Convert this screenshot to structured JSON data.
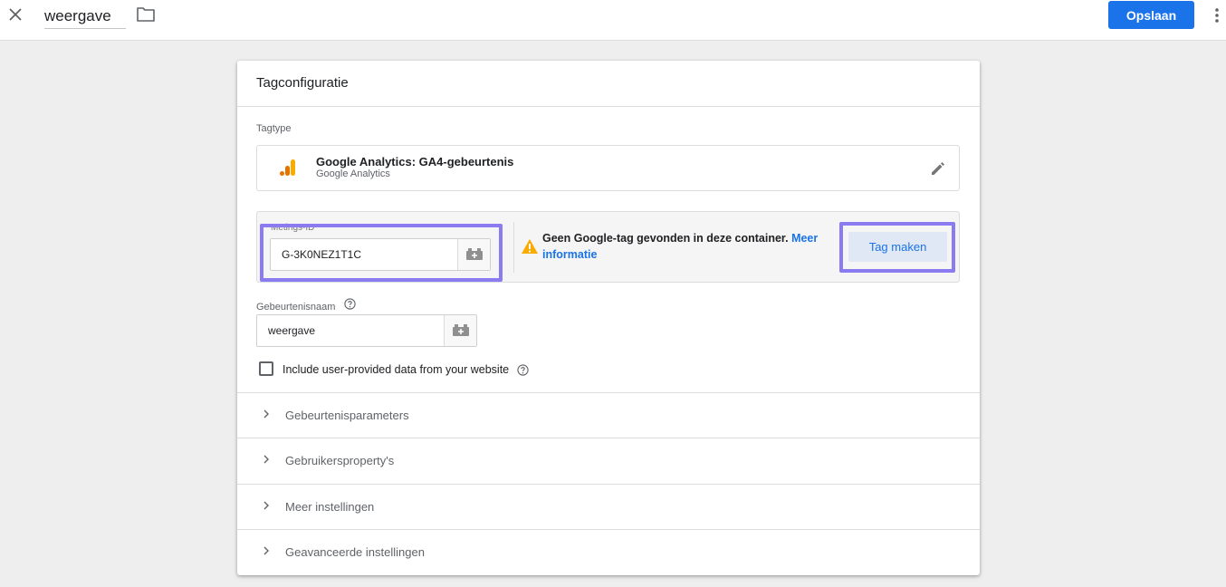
{
  "topbar": {
    "tag_name_value": "weergave",
    "save_label": "Opslaan"
  },
  "card": {
    "title": "Tagconfiguratie",
    "tagtype_label": "Tagtype",
    "tagtype_name": "Google Analytics: GA4-gebeurtenis",
    "tagtype_sub": "Google Analytics",
    "measurement_label": "Metings-ID",
    "measurement_id_value": "G-3K0NEZ1T1C",
    "warning_text": "Geen Google-tag gevonden in deze container.",
    "warning_link": "Meer informatie",
    "create_tag_label": "Tag maken",
    "event_name_label": "Gebeurtenisnaam",
    "event_name_value": "weergave",
    "checkbox_label": "Include user-provided data from your website",
    "accordions": [
      {
        "label": "Gebeurtenisparameters"
      },
      {
        "label": "Gebruikersproperty's"
      },
      {
        "label": "Meer instellingen"
      },
      {
        "label": "Geavanceerde instellingen"
      }
    ]
  },
  "colors": {
    "accent": "#1a73e8",
    "highlight": "#8a7cf0",
    "ga_orange": "#f9ab00",
    "ga_orange_dark": "#e37400",
    "warning": "#f9ab00"
  }
}
